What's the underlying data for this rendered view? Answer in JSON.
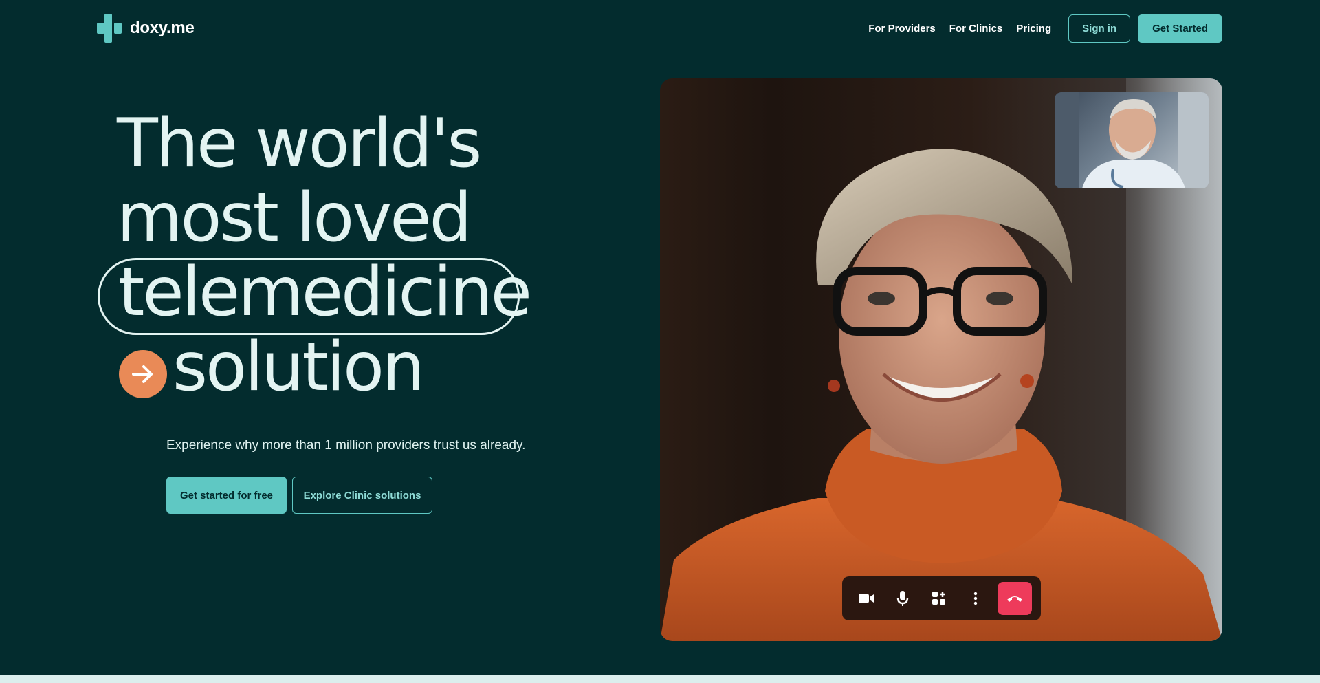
{
  "brand": {
    "name": "doxy.me",
    "accent": "#5fc8c3",
    "background": "#032c2e",
    "highlight": "#e98a57",
    "end_call": "#ee3b5b"
  },
  "nav": {
    "links": [
      "For Providers",
      "For Clinics",
      "Pricing"
    ],
    "sign_in": "Sign in",
    "get_started": "Get Started"
  },
  "hero": {
    "line1": "The world's",
    "line2": "most loved",
    "line3": "telemedicine",
    "line4": "solution",
    "subtext": "Experience why more than 1 million providers trust us already.",
    "cta_primary": "Get started for free",
    "cta_secondary": "Explore Clinic solutions"
  },
  "video_call": {
    "main_participant": "patient-video",
    "pip_participant": "doctor-video",
    "controls": [
      "video-camera-icon",
      "microphone-icon",
      "apps-add-icon",
      "more-vertical-icon",
      "end-call-icon"
    ]
  }
}
